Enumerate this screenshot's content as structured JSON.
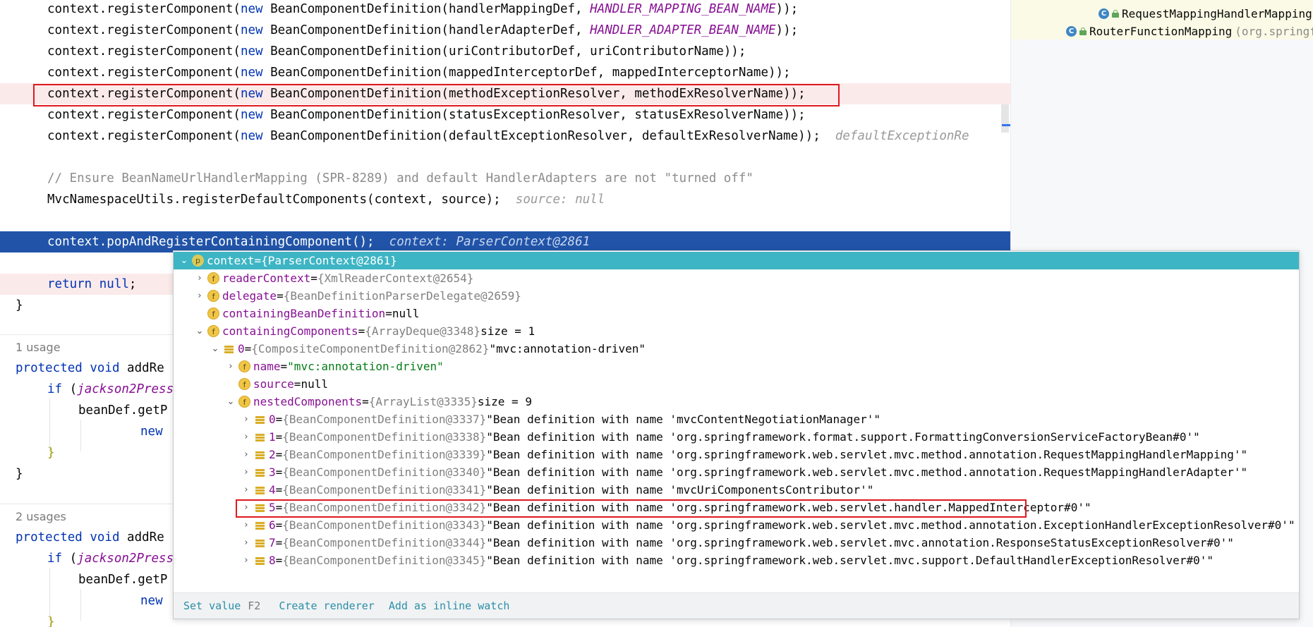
{
  "structure": {
    "item1": {
      "name": "RequestMappingHandlerMapping"
    },
    "item2": {
      "name": "RouterFunctionMapping",
      "pkg": "(org.springfr"
    }
  },
  "code": {
    "reg1": {
      "pre": "context.registerComponent(",
      "kw": "new",
      "mid": " BeanComponentDefinition(handlerMappingDef, ",
      "const": "HANDLER_MAPPING_BEAN_NAME",
      "post": "));"
    },
    "reg2": {
      "pre": "context.registerComponent(",
      "kw": "new",
      "mid": " BeanComponentDefinition(handlerAdapterDef, ",
      "const": "HANDLER_ADAPTER_BEAN_NAME",
      "post": "));"
    },
    "reg3": {
      "pre": "context.registerComponent(",
      "kw": "new",
      "post": " BeanComponentDefinition(uriContributorDef, uriContributorName));"
    },
    "reg4": {
      "pre": "context.registerComponent(",
      "kw": "new",
      "post": " BeanComponentDefinition(mappedInterceptorDef, mappedInterceptorName));"
    },
    "reg5": {
      "pre": "context.registerComponent(",
      "kw": "new",
      "post": " BeanComponentDefinition(methodExceptionResolver, methodExResolverName));"
    },
    "reg6": {
      "pre": "context.registerComponent(",
      "kw": "new",
      "post": " BeanComponentDefinition(statusExceptionResolver, statusExResolverName));"
    },
    "reg7": {
      "pre": "context.registerComponent(",
      "kw": "new",
      "post": " BeanComponentDefinition(defaultExceptionResolver, defaultExResolverName));",
      "hint": "defaultExceptionRe"
    },
    "comment": "// Ensure BeanNameUrlHandlerMapping (SPR-8289) and default HandlerAdapters are not \"turned off\"",
    "mvc": {
      "text": "MvcNamespaceUtils.registerDefaultComponents(context, source);",
      "hint": "source: null"
    },
    "pop": {
      "text": "context.popAndRegisterContainingComponent();",
      "hint": "context: ParserContext@2861"
    },
    "ret": {
      "kw": "return",
      "sp": " ",
      "kw2": "null",
      "post": ";"
    },
    "brace1": "}",
    "usage1": "1 usage",
    "m1": {
      "kw": "protected void",
      "name": " addRe"
    },
    "if1": {
      "kw": "if",
      "open": " (",
      "var": "jackson2Press"
    },
    "bd1": "beanDef.getP",
    "new1": "new",
    "brace_in1": "}",
    "brace2": "}",
    "usage2": "2 usages",
    "m2": {
      "kw": "protected void",
      "name": " addRe"
    },
    "if2": {
      "kw": "if",
      "open": " (",
      "var": "jackson2Press"
    },
    "bd2": "beanDef.getP",
    "new2": "new",
    "brace_in2": "}"
  },
  "debug": {
    "root": {
      "name": "context",
      "eq": " = ",
      "ref": "{ParserContext@2861}"
    },
    "readerContext": {
      "name": "readerContext",
      "eq": " = ",
      "ref": "{XmlReaderContext@2654}"
    },
    "delegate": {
      "name": "delegate",
      "eq": " = ",
      "ref": "{BeanDefinitionParserDelegate@2659}"
    },
    "containingBeanDefinition": {
      "name": "containingBeanDefinition",
      "eq": " = ",
      "val": "null"
    },
    "containingComponents": {
      "name": "containingComponents",
      "eq": " = ",
      "ref": "{ArrayDeque@3348}",
      "val": "  size = 1"
    },
    "item0": {
      "name": "0",
      "eq": " = ",
      "ref": "{CompositeComponentDefinition@2862}",
      "val": " \"mvc:annotation-driven\""
    },
    "nameField": {
      "name": "name",
      "eq": " = ",
      "str": "\"mvc:annotation-driven\""
    },
    "sourceField": {
      "name": "source",
      "eq": " = ",
      "val": "null"
    },
    "nested": {
      "name": "nestedComponents",
      "eq": " = ",
      "ref": "{ArrayList@3335}",
      "val": "  size = 9"
    },
    "nestedItems": [
      {
        "idx": "0",
        "ref": "{BeanComponentDefinition@3337}",
        "val": " \"Bean definition with name 'mvcContentNegotiationManager'\""
      },
      {
        "idx": "1",
        "ref": "{BeanComponentDefinition@3338}",
        "val": " \"Bean definition with name 'org.springframework.format.support.FormattingConversionServiceFactoryBean#0'\""
      },
      {
        "idx": "2",
        "ref": "{BeanComponentDefinition@3339}",
        "val": " \"Bean definition with name 'org.springframework.web.servlet.mvc.method.annotation.RequestMappingHandlerMapping'\""
      },
      {
        "idx": "3",
        "ref": "{BeanComponentDefinition@3340}",
        "val": " \"Bean definition with name 'org.springframework.web.servlet.mvc.method.annotation.RequestMappingHandlerAdapter'\""
      },
      {
        "idx": "4",
        "ref": "{BeanComponentDefinition@3341}",
        "val": " \"Bean definition with name 'mvcUriComponentsContributor'\""
      },
      {
        "idx": "5",
        "ref": "{BeanComponentDefinition@3342}",
        "val": " \"Bean definition with name 'org.springframework.web.servlet.handler.MappedInterceptor#0'\""
      },
      {
        "idx": "6",
        "ref": "{BeanComponentDefinition@3343}",
        "val": " \"Bean definition with name 'org.springframework.web.servlet.mvc.method.annotation.ExceptionHandlerExceptionResolver#0'\""
      },
      {
        "idx": "7",
        "ref": "{BeanComponentDefinition@3344}",
        "val": " \"Bean definition with name 'org.springframework.web.servlet.mvc.annotation.ResponseStatusExceptionResolver#0'\""
      },
      {
        "idx": "8",
        "ref": "{BeanComponentDefinition@3345}",
        "val": " \"Bean definition with name 'org.springframework.web.servlet.mvc.support.DefaultHandlerExceptionResolver#0'\""
      }
    ],
    "eq": " = ",
    "footer": {
      "setValue": "Set value",
      "setValueKey": "F2",
      "createRenderer": "Create renderer",
      "addWatch": "Add as inline watch"
    }
  }
}
